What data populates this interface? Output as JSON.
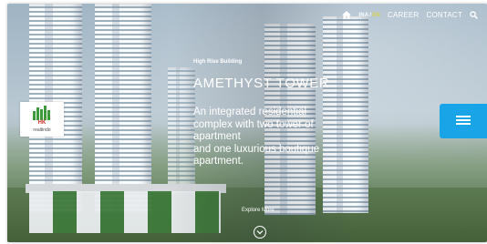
{
  "nav": {
    "home_icon": "home-icon",
    "lang_active": "INA",
    "lang_separator": "/",
    "lang_inactive": "EN",
    "career_label": "CAREER",
    "contact_label": "CONTACT",
    "search_icon": "search-icon"
  },
  "logo": {
    "mark_text": "HK",
    "caption": "realtindo"
  },
  "hero": {
    "kicker": "High Rise Building",
    "title": "AMETHYST TOWER",
    "description_lines": [
      "An integrated residential",
      "complex with two tower of",
      "apartment",
      "and one luxurious boutique",
      "apartment."
    ],
    "explore_label": "Explore More",
    "explore_icon": "chevron-down-icon"
  },
  "menu": {
    "icon": "hamburger-menu-icon"
  },
  "colors": {
    "accent_blue": "#1aa4e8",
    "lang_inactive_yellow": "#d8d34a",
    "logo_green": "#3d9a3a",
    "logo_red": "#d22b2b"
  }
}
